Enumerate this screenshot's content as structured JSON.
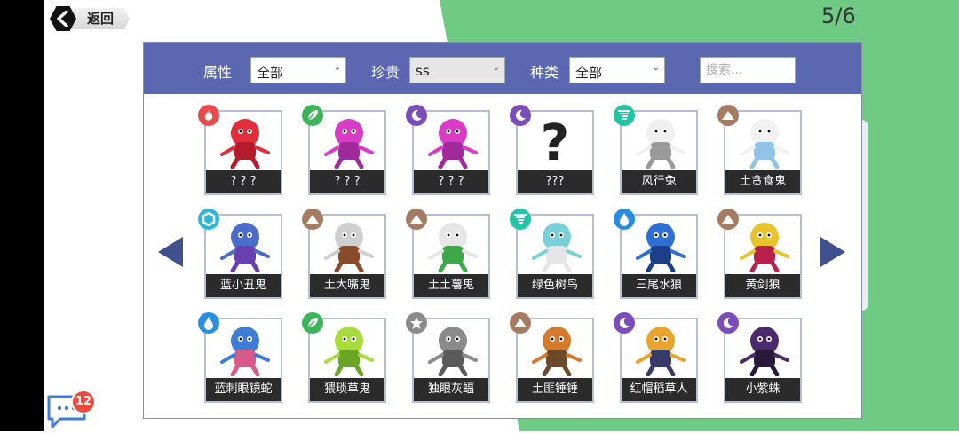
{
  "header": {
    "back_label": "返回",
    "page_indicator": "5/6"
  },
  "filters": {
    "attribute_label": "属性",
    "attribute_value": "全部",
    "rarity_label": "珍贵",
    "rarity_value": "ss",
    "species_label": "种类",
    "species_value": "全部",
    "search_placeholder": "搜索..."
  },
  "colors": {
    "panel_header": "#5b67b0",
    "fire": "#e74c4c",
    "grass": "#3cb45a",
    "dark": "#7b4dbb",
    "wind": "#24c4a5",
    "earth": "#a57b62",
    "water": "#2a8ee0",
    "light": "#2bb8d9",
    "neutral": "#8a8a8a"
  },
  "cards": [
    {
      "name": "? ? ?",
      "element": "fire",
      "icon": "flame-icon"
    },
    {
      "name": "? ? ?",
      "element": "grass",
      "icon": "leaf-icon"
    },
    {
      "name": "? ? ?",
      "element": "dark",
      "icon": "moon-icon"
    },
    {
      "name": "???",
      "element": "dark",
      "icon": "moon-icon"
    },
    {
      "name": "风行兔",
      "element": "wind",
      "icon": "tornado-icon"
    },
    {
      "name": "土贪食鬼",
      "element": "earth",
      "icon": "mountain-icon"
    },
    {
      "name": "蓝小丑鬼",
      "element": "light",
      "icon": "hexagon-icon"
    },
    {
      "name": "土大嘴鬼",
      "element": "earth",
      "icon": "mountain-icon"
    },
    {
      "name": "土土薯鬼",
      "element": "earth",
      "icon": "mountain-icon"
    },
    {
      "name": "绿色树鸟",
      "element": "wind",
      "icon": "tornado-icon"
    },
    {
      "name": "三尾水狼",
      "element": "water",
      "icon": "water-drop-icon"
    },
    {
      "name": "黄剑狼",
      "element": "earth",
      "icon": "mountain-icon"
    },
    {
      "name": "蓝刺眼镜蛇",
      "element": "water",
      "icon": "water-drop-icon"
    },
    {
      "name": "猥琐草鬼",
      "element": "grass",
      "icon": "leaf-icon"
    },
    {
      "name": "独眼灰蝠",
      "element": "neutral",
      "icon": "star-icon"
    },
    {
      "name": "土匪锤锤",
      "element": "earth",
      "icon": "mountain-icon"
    },
    {
      "name": "红帽稻草人",
      "element": "dark",
      "icon": "moon-icon"
    },
    {
      "name": "小紫蛛",
      "element": "dark",
      "icon": "moon-icon"
    }
  ],
  "chat": {
    "unread_count": "12"
  }
}
